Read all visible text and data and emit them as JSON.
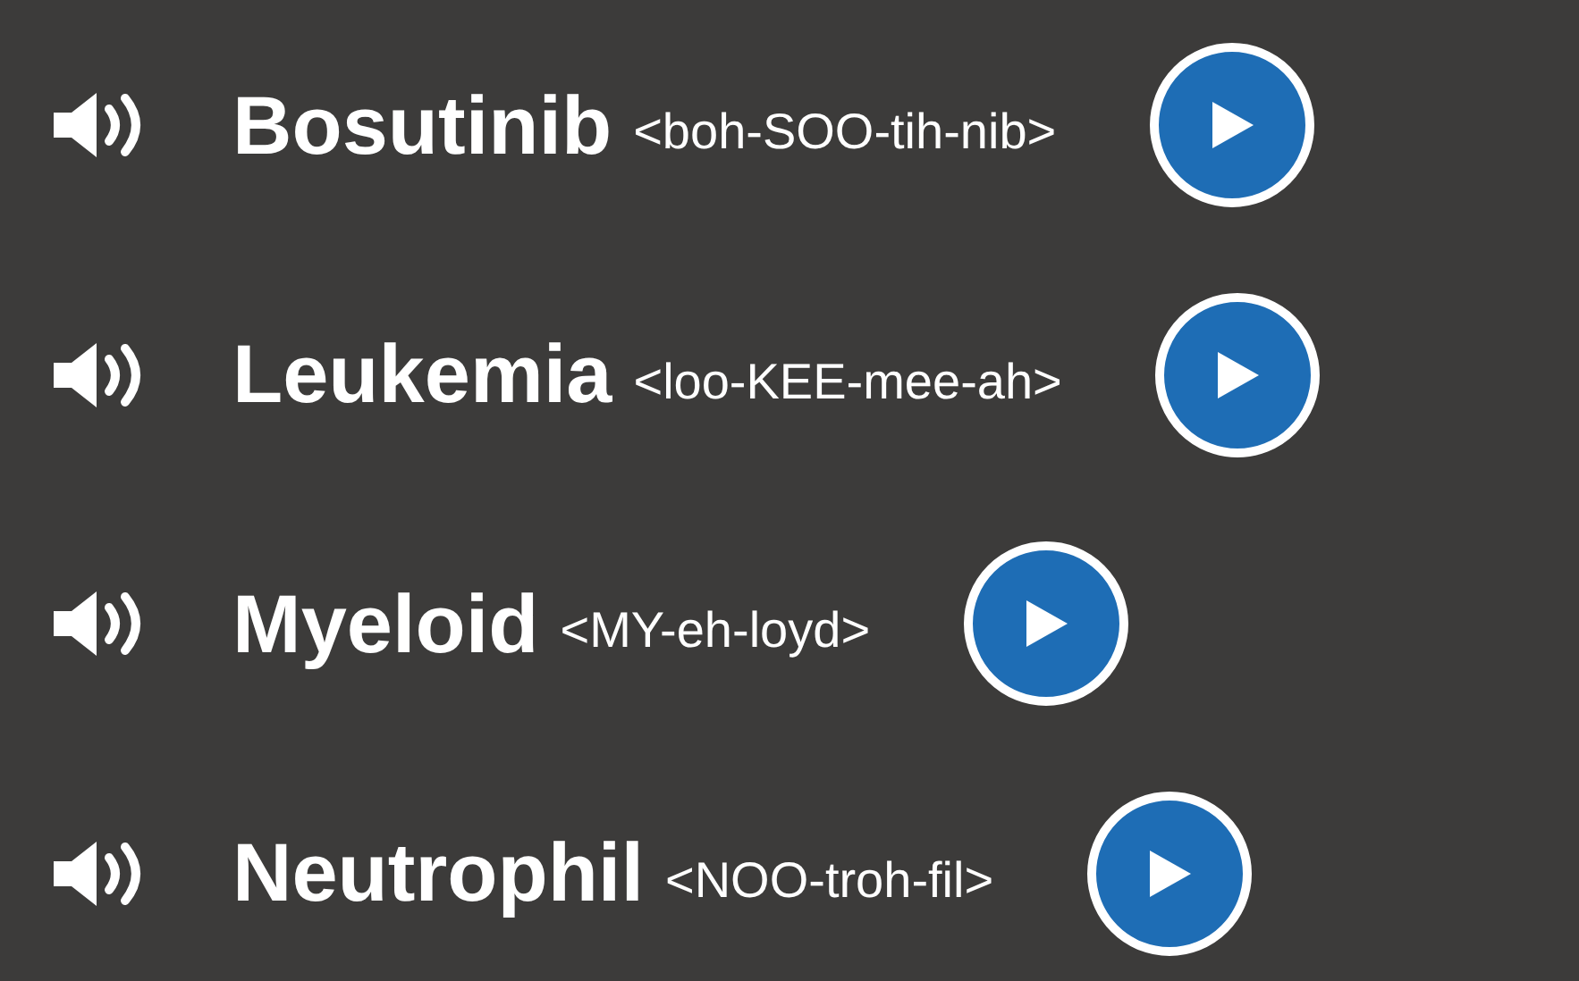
{
  "terms": [
    {
      "word": "Bosutinib",
      "pronunciation": "<boh-SOO-tih-nib>"
    },
    {
      "word": "Leukemia",
      "pronunciation": "<loo-KEE-mee-ah>"
    },
    {
      "word": "Myeloid",
      "pronunciation": "<MY-eh-loyd>"
    },
    {
      "word": "Neutrophil",
      "pronunciation": "<NOO-troh-fil>"
    }
  ]
}
